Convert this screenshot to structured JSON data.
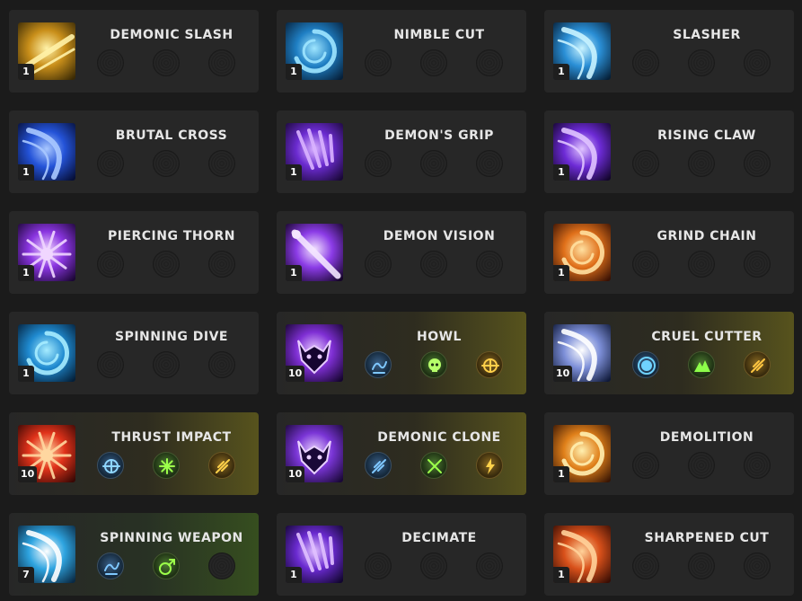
{
  "colors": {
    "background": "#1b1b1b",
    "card": "#272727",
    "gold_glow": "#57531d",
    "green_glow": "#364e1f",
    "text": "#e6e6e6"
  },
  "skills": [
    {
      "name": "DEMONIC SLASH",
      "level": "1",
      "icon": "golden-slash-icon",
      "highlight": "none",
      "tripods": [
        "empty",
        "empty",
        "empty"
      ]
    },
    {
      "name": "NIMBLE CUT",
      "level": "1",
      "icon": "blue-swirl-blades-icon",
      "highlight": "none",
      "tripods": [
        "empty",
        "empty",
        "empty"
      ]
    },
    {
      "name": "SLASHER",
      "level": "1",
      "icon": "blue-crescent-slash-icon",
      "highlight": "none",
      "tripods": [
        "empty",
        "empty",
        "empty"
      ]
    },
    {
      "name": "BRUTAL CROSS",
      "level": "1",
      "icon": "blue-cross-slash-icon",
      "highlight": "none",
      "tripods": [
        "empty",
        "empty",
        "empty"
      ]
    },
    {
      "name": "DEMON'S GRIP",
      "level": "1",
      "icon": "purple-claw-hand-icon",
      "highlight": "none",
      "tripods": [
        "empty",
        "empty",
        "empty"
      ]
    },
    {
      "name": "RISING CLAW",
      "level": "1",
      "icon": "purple-rising-claw-icon",
      "highlight": "none",
      "tripods": [
        "empty",
        "empty",
        "empty"
      ]
    },
    {
      "name": "PIERCING THORN",
      "level": "1",
      "icon": "purple-thorn-burst-icon",
      "highlight": "none",
      "tripods": [
        "empty",
        "empty",
        "empty"
      ]
    },
    {
      "name": "DEMON VISION",
      "level": "1",
      "icon": "purple-beam-icon",
      "highlight": "none",
      "tripods": [
        "empty",
        "empty",
        "empty"
      ]
    },
    {
      "name": "GRIND CHAIN",
      "level": "1",
      "icon": "orange-chain-icon",
      "highlight": "none",
      "tripods": [
        "empty",
        "empty",
        "empty"
      ]
    },
    {
      "name": "SPINNING DIVE",
      "level": "1",
      "icon": "blue-vortex-icon",
      "highlight": "none",
      "tripods": [
        "empty",
        "empty",
        "empty"
      ]
    },
    {
      "name": "HOWL",
      "level": "10",
      "icon": "purple-demon-howl-icon",
      "highlight": "gold",
      "tripods": [
        "blue-wave-icon",
        "green-skull-icon",
        "gold-target-icon"
      ]
    },
    {
      "name": "CRUEL CUTTER",
      "level": "10",
      "icon": "silver-cutter-icon",
      "highlight": "gold",
      "tripods": [
        "blue-orb-icon",
        "green-mountain-icon",
        "gold-feather-icon"
      ]
    },
    {
      "name": "THRUST IMPACT",
      "level": "10",
      "icon": "red-impact-icon",
      "highlight": "gold",
      "tripods": [
        "blue-target-icon",
        "green-burst-icon",
        "gold-streak-icon"
      ]
    },
    {
      "name": "DEMONIC CLONE",
      "level": "10",
      "icon": "purple-clone-icon",
      "highlight": "gold",
      "tripods": [
        "blue-claw-icon",
        "green-cross-icon",
        "gold-bolt-icon"
      ]
    },
    {
      "name": "DEMOLITION",
      "level": "1",
      "icon": "orange-demolition-icon",
      "highlight": "none",
      "tripods": [
        "empty",
        "empty",
        "empty"
      ]
    },
    {
      "name": "SPINNING WEAPON",
      "level": "7",
      "icon": "blue-spinning-weapon-icon",
      "highlight": "green",
      "tripods": [
        "blue-wave-icon",
        "green-arrow-icon",
        "empty"
      ]
    },
    {
      "name": "DECIMATE",
      "level": "1",
      "icon": "purple-decimate-icon",
      "highlight": "none",
      "tripods": [
        "empty",
        "empty",
        "empty"
      ]
    },
    {
      "name": "SHARPENED CUT",
      "level": "1",
      "icon": "orange-sharpened-icon",
      "highlight": "none",
      "tripods": [
        "empty",
        "empty",
        "empty"
      ]
    }
  ]
}
